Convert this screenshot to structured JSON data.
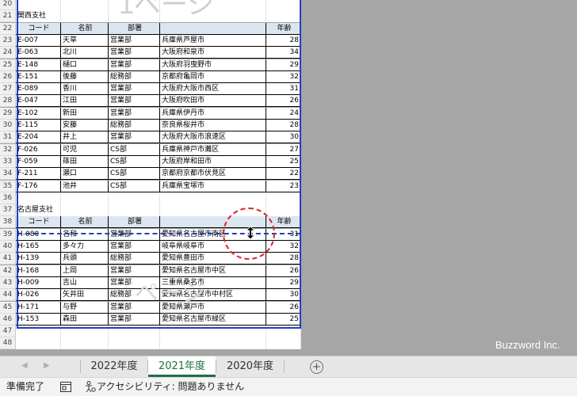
{
  "sheet": {
    "page_watermark_top": "1ページ",
    "page_watermark_bottom": "ページ",
    "rows": [
      {
        "n": "20",
        "type": "empty"
      },
      {
        "n": "21",
        "type": "title",
        "text": "関西支社"
      },
      {
        "n": "22",
        "type": "header",
        "cells": [
          "コード",
          "名前",
          "部署",
          "",
          "年齢"
        ]
      },
      {
        "n": "23",
        "type": "data",
        "cells": [
          "E-007",
          "天草",
          "営業部",
          "兵庫県芦屋市",
          "28"
        ]
      },
      {
        "n": "24",
        "type": "data",
        "cells": [
          "E-063",
          "北川",
          "営業部",
          "大阪府和泉市",
          "34"
        ]
      },
      {
        "n": "25",
        "type": "data",
        "cells": [
          "E-148",
          "樋口",
          "営業部",
          "大阪府羽曳野市",
          "29"
        ]
      },
      {
        "n": "26",
        "type": "data",
        "cells": [
          "E-151",
          "後藤",
          "総務部",
          "京都府亀岡市",
          "32"
        ]
      },
      {
        "n": "27",
        "type": "data",
        "cells": [
          "E-089",
          "香川",
          "営業部",
          "大阪府大阪市西区",
          "31"
        ]
      },
      {
        "n": "28",
        "type": "data",
        "cells": [
          "E-047",
          "江田",
          "営業部",
          "大阪府吹田市",
          "26"
        ]
      },
      {
        "n": "29",
        "type": "data",
        "cells": [
          "E-102",
          "新田",
          "営業部",
          "兵庫県伊丹市",
          "24"
        ]
      },
      {
        "n": "30",
        "type": "data",
        "cells": [
          "E-115",
          "安藤",
          "総務部",
          "奈良県桜井市",
          "28"
        ]
      },
      {
        "n": "31",
        "type": "data",
        "cells": [
          "E-204",
          "井上",
          "営業部",
          "大阪府大阪市浪速区",
          "30"
        ]
      },
      {
        "n": "32",
        "type": "data",
        "cells": [
          "F-026",
          "可児",
          "CS部",
          "兵庫県神戸市灘区",
          "27"
        ]
      },
      {
        "n": "33",
        "type": "data",
        "cells": [
          "F-059",
          "篠田",
          "CS部",
          "大阪府岸和田市",
          "25"
        ]
      },
      {
        "n": "34",
        "type": "data",
        "cells": [
          "F-211",
          "瀬口",
          "CS部",
          "京都府京都市伏見区",
          "22"
        ]
      },
      {
        "n": "35",
        "type": "data",
        "cells": [
          "F-176",
          "池井",
          "CS部",
          "兵庫県宝塚市",
          "23"
        ]
      },
      {
        "n": "36",
        "type": "empty"
      },
      {
        "n": "37",
        "type": "title",
        "text": "名古屋支社"
      },
      {
        "n": "38",
        "type": "header",
        "cells": [
          "コード",
          "名前",
          "部署",
          "",
          "年齢"
        ]
      },
      {
        "n": "39",
        "type": "data",
        "cells": [
          "H-080",
          "名和",
          "営業部",
          "愛知県名古屋市南区",
          "31"
        ]
      },
      {
        "n": "40",
        "type": "data",
        "cells": [
          "H-165",
          "多々力",
          "営業部",
          "岐阜県岐阜市",
          "32"
        ]
      },
      {
        "n": "41",
        "type": "data",
        "cells": [
          "H-139",
          "兵頭",
          "総務部",
          "愛知県豊田市",
          "28"
        ]
      },
      {
        "n": "42",
        "type": "data",
        "cells": [
          "H-168",
          "上岡",
          "営業部",
          "愛知県名古屋市中区",
          "26"
        ]
      },
      {
        "n": "43",
        "type": "data",
        "cells": [
          "H-009",
          "吉山",
          "営業部",
          "三重県桑名市",
          "29"
        ]
      },
      {
        "n": "44",
        "type": "data",
        "cells": [
          "H-026",
          "矢井田",
          "総務部",
          "愛知県名古屋市中村区",
          "30"
        ]
      },
      {
        "n": "45",
        "type": "data",
        "cells": [
          "H-171",
          "与野",
          "営業部",
          "愛知県瀬戸市",
          "26"
        ]
      },
      {
        "n": "46",
        "type": "data",
        "cells": [
          "H-153",
          "森田",
          "営業部",
          "愛知県名古屋市緑区",
          "25"
        ]
      },
      {
        "n": "47",
        "type": "empty"
      },
      {
        "n": "48",
        "type": "empty"
      }
    ]
  },
  "tabs": [
    {
      "label": "2022年度",
      "active": false
    },
    {
      "label": "2021年度",
      "active": true
    },
    {
      "label": "2020年度",
      "active": false
    }
  ],
  "status": {
    "ready": "準備完了",
    "accessibility": "アクセシビリティ: 問題ありません"
  },
  "watermark": "Buzzword Inc.",
  "icons": {
    "prev": "nav-left-icon",
    "next": "nav-right-icon",
    "add": "add-sheet-icon",
    "macro": "macro-record-icon",
    "accessibility": "accessibility-icon",
    "cursor": "resize-vertical-cursor-icon"
  },
  "colors": {
    "header_fill": "#dce6f1",
    "page_break": "#1f3fbf",
    "highlight_circle": "#d9262c",
    "active_tab": "#1e7145"
  }
}
